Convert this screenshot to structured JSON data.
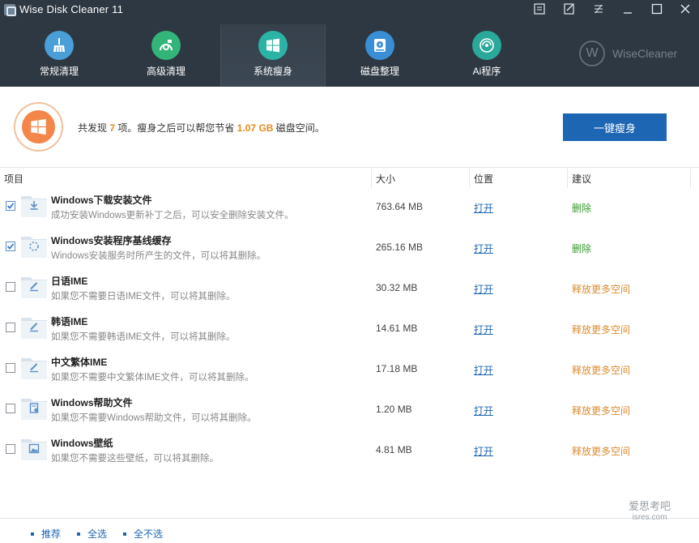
{
  "app": {
    "title": "Wise Disk Cleaner 11"
  },
  "window_controls": [
    "menu-icon",
    "feedback-icon",
    "skin-icon",
    "minimize-icon",
    "maximize-icon",
    "close-icon"
  ],
  "nav": {
    "items": [
      {
        "label": "常规清理",
        "icon": "broom-icon",
        "color": "#4a9fd8"
      },
      {
        "label": "高级清理",
        "icon": "advanced-clean-icon",
        "color": "#33b57a"
      },
      {
        "label": "系统瘦身",
        "icon": "windows-icon",
        "color": "#2bb3a6",
        "active": true
      },
      {
        "label": "磁盘整理",
        "icon": "disk-defrag-icon",
        "color": "#3a8ed6"
      },
      {
        "label": "Ai程序",
        "icon": "ai-program-icon",
        "color": "#2aa99a"
      }
    ]
  },
  "brand": {
    "mark": "W",
    "text": "WiseCleaner"
  },
  "summary": {
    "prefix": "共发现",
    "count": "7",
    "middle": "项。瘦身之后可以帮您节省",
    "size": "1.07 GB",
    "suffix": "磁盘空间。",
    "button": "一键瘦身"
  },
  "table": {
    "headers": {
      "item": "项目",
      "size": "大小",
      "location": "位置",
      "advice": "建议"
    },
    "open_label": "打开",
    "rows": [
      {
        "checked": true,
        "icon": "download-icon",
        "title": "Windows下载安装文件",
        "desc": "成功安装Windows更新补丁之后，可以安全删除安装文件。",
        "size": "763.64 MB",
        "advice": "删除",
        "advice_type": "delete"
      },
      {
        "checked": true,
        "icon": "loading-icon",
        "title": "Windows安装程序基线缓存",
        "desc": "Windows安装服务时所产生的文件，可以将其删除。",
        "size": "265.16 MB",
        "advice": "删除",
        "advice_type": "delete"
      },
      {
        "checked": false,
        "icon": "pen-icon",
        "title": "日语IME",
        "desc": "如果您不需要日语IME文件，可以将其删除。",
        "size": "30.32 MB",
        "advice": "释放更多空间",
        "advice_type": "free"
      },
      {
        "checked": false,
        "icon": "pen-icon",
        "title": "韩语IME",
        "desc": "如果您不需要韩语IME文件，可以将其删除。",
        "size": "14.61 MB",
        "advice": "释放更多空间",
        "advice_type": "free"
      },
      {
        "checked": false,
        "icon": "pen-icon",
        "title": "中文繁体IME",
        "desc": "如果您不需要中文繁体IME文件，可以将其删除。",
        "size": "17.18 MB",
        "advice": "释放更多空间",
        "advice_type": "free"
      },
      {
        "checked": false,
        "icon": "help-file-icon",
        "title": "Windows帮助文件",
        "desc": "如果您不需要Windows帮助文件，可以将其删除。",
        "size": "1.20 MB",
        "advice": "释放更多空间",
        "advice_type": "free"
      },
      {
        "checked": false,
        "icon": "image-icon",
        "title": "Windows壁纸",
        "desc": "如果您不需要这些壁纸，可以将其删除。",
        "size": "4.81 MB",
        "advice": "释放更多空间",
        "advice_type": "free"
      }
    ]
  },
  "footer": {
    "recommend": "推荐",
    "select_all": "全选",
    "select_none": "全不选"
  },
  "watermark": {
    "line1": "爱思考吧",
    "line2": "isres.com"
  }
}
